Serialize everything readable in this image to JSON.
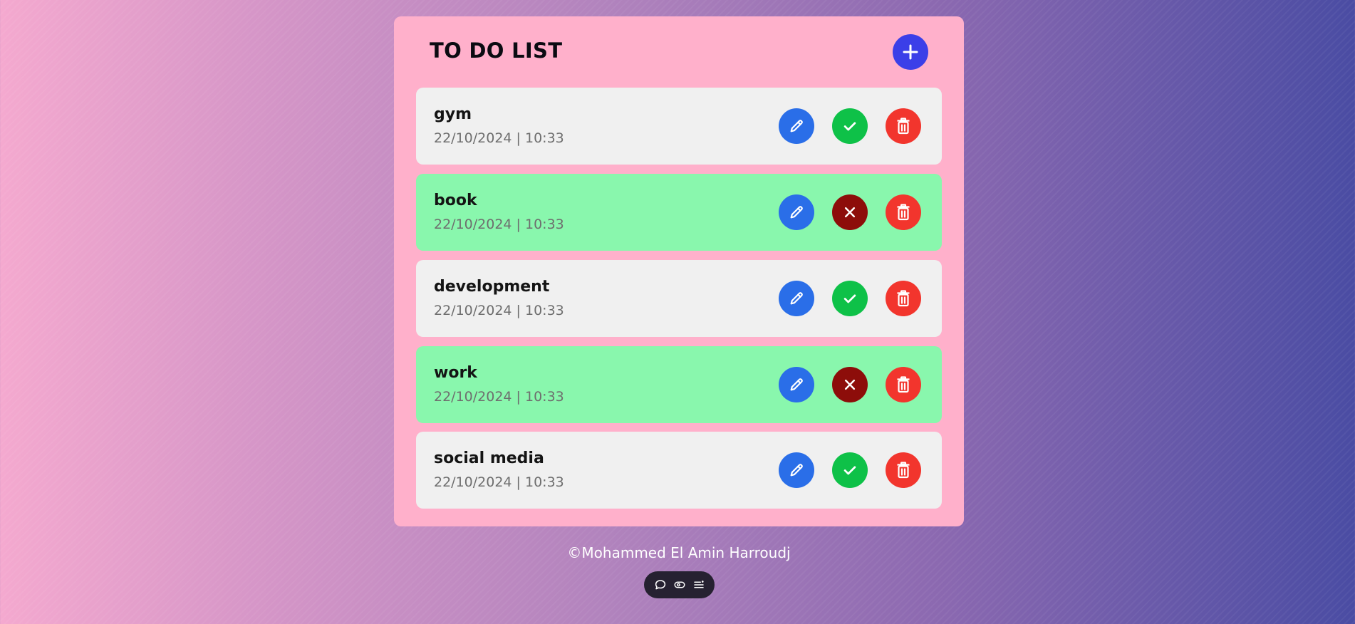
{
  "header": {
    "title": "TO DO LIST",
    "add_icon": "plus-icon"
  },
  "tasks": [
    {
      "name": "gym",
      "datetime": "22/10/2024 | 10:33",
      "completed": false
    },
    {
      "name": "book",
      "datetime": "22/10/2024 | 10:33",
      "completed": true
    },
    {
      "name": "development",
      "datetime": "22/10/2024 | 10:33",
      "completed": false
    },
    {
      "name": "work",
      "datetime": "22/10/2024 | 10:33",
      "completed": true
    },
    {
      "name": "social media",
      "datetime": "22/10/2024 | 10:33",
      "completed": false
    }
  ],
  "icons": {
    "edit": "pencil-icon",
    "complete": "check-icon",
    "undo": "close-icon",
    "delete": "trash-icon"
  },
  "footer": {
    "text": "©Mohammed El Amin Harroudj"
  },
  "toolbar": {
    "icons": [
      "chat-bubble-icon",
      "eye-icon",
      "menu-icon"
    ]
  },
  "colors": {
    "card": "#ffb0cb",
    "task_pending": "#f0f0f0",
    "task_done": "#89f7ad",
    "add": "#3b3fe8",
    "edit": "#2a6ee8",
    "complete": "#0ec148",
    "undo": "#8d0d0a",
    "delete": "#f2352d"
  }
}
